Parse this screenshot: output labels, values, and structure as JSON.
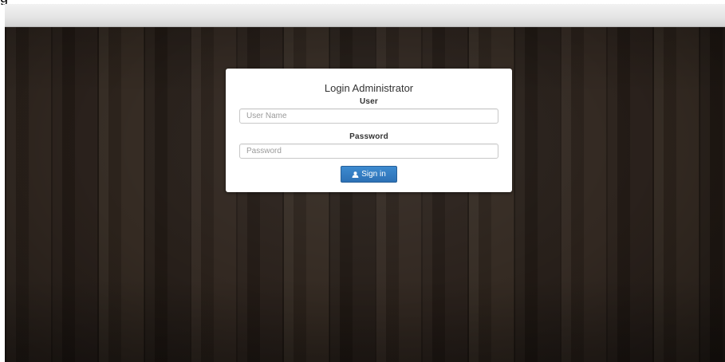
{
  "login": {
    "title": "Login Administrator",
    "user_label": "User",
    "user_placeholder": "User Name",
    "user_value": "",
    "password_label": "Password",
    "password_placeholder": "Password",
    "password_value": "",
    "signin_label": "Sign in",
    "signin_icon": "user-icon"
  },
  "colors": {
    "button": "#337ab7",
    "background": "#2a211b",
    "panel": "#ffffff"
  }
}
